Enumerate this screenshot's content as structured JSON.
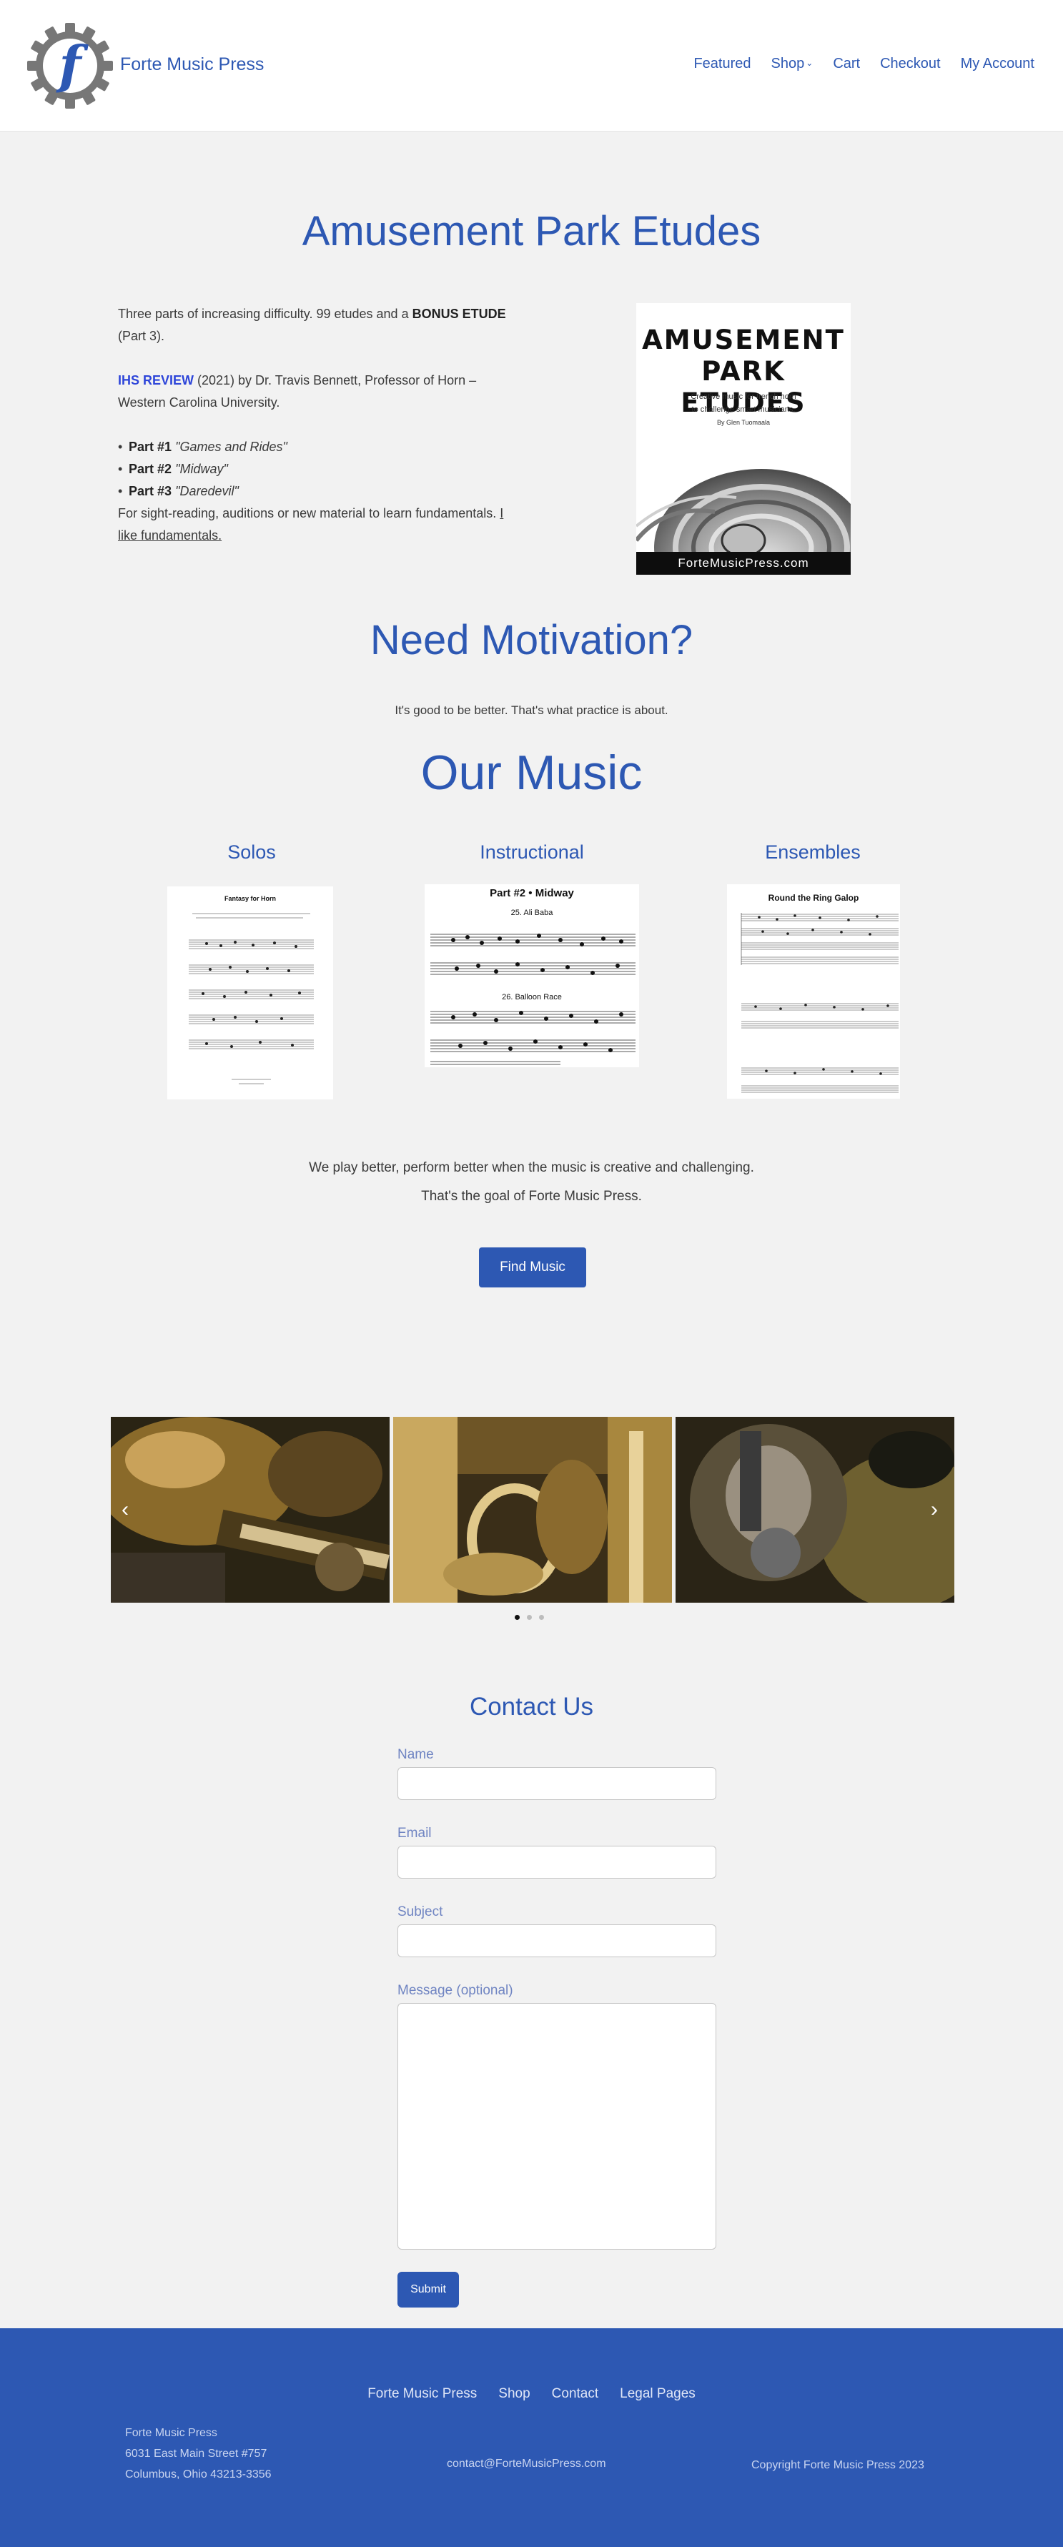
{
  "header": {
    "site_title": "Forte Music Press",
    "nav": [
      {
        "label": "Featured"
      },
      {
        "label": "Shop",
        "has_dropdown": true
      },
      {
        "label": "Cart"
      },
      {
        "label": "Checkout"
      },
      {
        "label": "My Account"
      }
    ]
  },
  "etudes": {
    "title": "Amusement Park Etudes",
    "intro_pre": "Three parts of increasing difficulty. 99 etudes and a ",
    "intro_bold": "BONUS ETUDE",
    "intro_post": " (Part 3).",
    "review_link": "IHS REVIEW",
    "review_text": " (2021) by Dr. Travis Bennett, Professor of Horn – Western Carolina University.",
    "parts": [
      {
        "label": "Part #1",
        "name": "\"Games and Rides\""
      },
      {
        "label": "Part #2",
        "name": "\"Midway\""
      },
      {
        "label": "Part #3",
        "name": "\"Daredevil\""
      }
    ],
    "outro": "For sight-reading, auditions or new material to learn fundamentals. ",
    "outro_link": "I like fundamentals.",
    "book": {
      "title_line1": "AMUSEMENT",
      "title_line2": "PARK ETUDES",
      "subtitle_line1": "Creative music for french horn",
      "subtitle_line2": "to challenge smart musicians.",
      "author": "By Glen Tuomaala",
      "footer": "FortеMusicPress.com"
    }
  },
  "motivation": {
    "title": "Need Motivation?",
    "text": "It's good to be better. That's what practice is about."
  },
  "music": {
    "title": "Our Music",
    "categories": [
      {
        "label": "Solos",
        "sheet_title": "Fantasy for Horn"
      },
      {
        "label": "Instructional",
        "sheet_title": "Part #2 • Midway",
        "piece1": "25. Ali Baba",
        "piece2": "26. Balloon Race"
      },
      {
        "label": "Ensembles",
        "sheet_title": "Round the Ring Galop"
      }
    ],
    "desc_line1": "We play better, perform better when the music is creative and challenging.",
    "desc_line2": "That's the goal of Forte Music Press.",
    "button": "Find Music"
  },
  "slider": {
    "prev_icon": "chevron-left-icon",
    "next_icon": "chevron-right-icon",
    "slides": 3,
    "active_dot": 0
  },
  "contact": {
    "title": "Contact Us",
    "fields": [
      {
        "label": "Name"
      },
      {
        "label": "Email"
      },
      {
        "label": "Subject"
      },
      {
        "label": "Message (optional)"
      }
    ],
    "submit": "Submit"
  },
  "footer": {
    "nav": [
      {
        "label": "Forte Music Press"
      },
      {
        "label": "Shop"
      },
      {
        "label": "Contact"
      },
      {
        "label": "Legal Pages"
      }
    ],
    "address_line1": "Forte Music Press",
    "address_line2": "6031 East Main Street #757",
    "address_line3": "Columbus, Ohio 43213-3356",
    "email": "contact@ForteMusicPress.com",
    "copyright": "Copyright Forte Music Press 2023"
  },
  "colors": {
    "brand": "#2d58b3",
    "background": "#f2f2f2",
    "footer": "#2d58b3"
  }
}
